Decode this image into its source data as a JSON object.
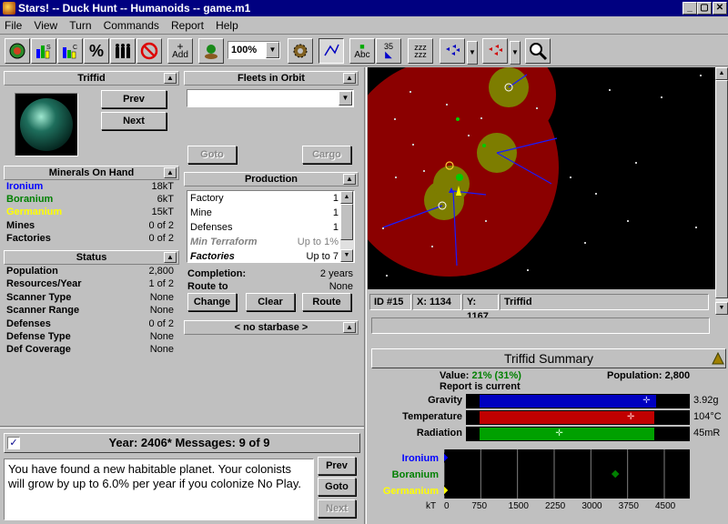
{
  "window": {
    "title": "Stars! -- Duck Hunt -- Humanoids -- game.m1",
    "minimize": "_",
    "restore": "▢",
    "close": "✕"
  },
  "menu": [
    "File",
    "View",
    "Turn",
    "Commands",
    "Report",
    "Help"
  ],
  "toolbar": {
    "add_label": "Add",
    "zoom_value": "100%",
    "waypoints_label": "35",
    "abc_label": "Abc"
  },
  "planet_panel": {
    "title": "Triffid",
    "prev": "Prev",
    "next": "Next"
  },
  "minerals": {
    "title": "Minerals On Hand",
    "rows": [
      {
        "label": "Ironium",
        "value": "18kT",
        "color": "#0000ff"
      },
      {
        "label": "Boranium",
        "value": "6kT",
        "color": "#008000"
      },
      {
        "label": "Germanium",
        "value": "15kT",
        "color": "#ffff00"
      }
    ],
    "mines_label": "Mines",
    "mines_value": "0 of 2",
    "factories_label": "Factories",
    "factories_value": "0 of 2"
  },
  "status": {
    "title": "Status",
    "rows": [
      {
        "label": "Population",
        "value": "2,800"
      },
      {
        "label": "Resources/Year",
        "value": "1 of 2"
      },
      {
        "label": "Scanner Type",
        "value": "None"
      },
      {
        "label": "Scanner Range",
        "value": "None"
      },
      {
        "label": "Defenses",
        "value": "0 of 2"
      },
      {
        "label": "Defense Type",
        "value": "None"
      },
      {
        "label": "Def Coverage",
        "value": "None"
      }
    ]
  },
  "fleets": {
    "title": "Fleets in Orbit",
    "goto": "Goto",
    "cargo": "Cargo"
  },
  "production": {
    "title": "Production",
    "items": [
      {
        "name": "Factory",
        "qty": "1",
        "style": "normal"
      },
      {
        "name": "Mine",
        "qty": "1",
        "style": "normal"
      },
      {
        "name": "Defenses",
        "qty": "1",
        "style": "normal"
      },
      {
        "name": "Min Terraform",
        "qty": "Up to 1%",
        "style": "gray"
      },
      {
        "name": "Factories",
        "qty": "Up to 7",
        "style": "bold"
      }
    ],
    "completion_label": "Completion:",
    "completion_value": "2 years",
    "route_label": "Route to",
    "route_value": "None",
    "change": "Change",
    "clear": "Clear",
    "route": "Route"
  },
  "starbase": {
    "label": "< no starbase >"
  },
  "messages": {
    "header": "Year: 2406*  Messages: 9 of 9",
    "text": "You have found a new habitable planet.  Your colonists will grow by up to 6.0% per year if you colonize No Play.",
    "prev": "Prev",
    "goto": "Goto",
    "next": "Next"
  },
  "map_info": {
    "id": "ID #15",
    "x": "X: 1134",
    "y": "Y: 1167",
    "name": "Triffid"
  },
  "summary": {
    "title": "Triffid Summary",
    "value_label": "Value:",
    "value": "21% (31%)",
    "population_label": "Population:",
    "population": "2,800",
    "report": "Report is current",
    "hab": [
      {
        "label": "Gravity",
        "reading": "3.92g",
        "color": "#0000c0",
        "range": [
          0.06,
          0.85
        ],
        "marker": 0.81
      },
      {
        "label": "Temperature",
        "reading": "104°C",
        "color": "#c00000",
        "range": [
          0.06,
          0.84
        ],
        "marker": 0.74
      },
      {
        "label": "Radiation",
        "reading": "45mR",
        "color": "#00a000",
        "range": [
          0.06,
          0.84
        ],
        "marker": 0.42
      }
    ],
    "minerals": [
      {
        "label": "Ironium",
        "color": "#0000ff",
        "value": 0
      },
      {
        "label": "Boranium",
        "color": "#008000",
        "value": 3500
      },
      {
        "label": "Germanium",
        "color": "#ffff00",
        "value": 0
      }
    ],
    "axis_unit": "kT",
    "axis_ticks": [
      "0",
      "750",
      "1500",
      "2250",
      "3000",
      "3750",
      "4500"
    ]
  }
}
